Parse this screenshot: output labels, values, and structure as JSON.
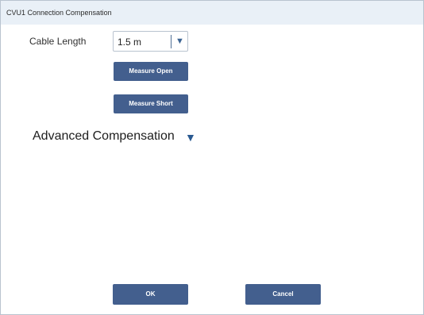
{
  "window": {
    "title": "CVU1 Connection Compensation"
  },
  "cable": {
    "label": "Cable Length",
    "selected": "1.5 m",
    "arrow": "▼"
  },
  "buttons": {
    "measure_open": "Measure Open",
    "measure_short": "Measure Short",
    "ok": "OK",
    "cancel": "Cancel"
  },
  "advanced": {
    "title": "Advanced Compensation",
    "arrow": "▼"
  },
  "icons": {
    "select_dropdown": "chevron-down-icon",
    "advanced_toggle": "triangle-down-icon"
  },
  "colors": {
    "accent": "#435f8e",
    "titlebar": "#e9f0f7",
    "arrow": "#2a5a91"
  }
}
